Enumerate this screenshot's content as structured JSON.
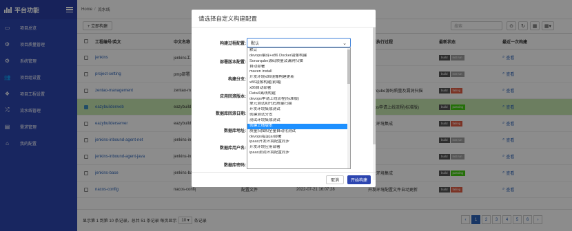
{
  "app": {
    "title": "平台功能"
  },
  "sidebar": {
    "items": [
      {
        "label": "项目总览",
        "icon": "monitor-icon"
      },
      {
        "label": "项目质量管理",
        "icon": "cog-icon"
      },
      {
        "label": "系统管理",
        "icon": "cog-icon"
      },
      {
        "label": "项目组设置",
        "icon": "users-icon"
      },
      {
        "label": "项目工程设置",
        "icon": "cluster-icon"
      },
      {
        "label": "流水线管理",
        "icon": "shuffle-icon"
      },
      {
        "label": "需求管理",
        "icon": "calendar-icon"
      },
      {
        "label": "我的配置",
        "icon": "sitemap-icon"
      }
    ]
  },
  "breadcrumb": {
    "home": "Home",
    "sep": "/",
    "current": "流水线"
  },
  "toolbar": {
    "add_label": "+ 立即构建",
    "search_placeholder": "搜索",
    "tools": [
      "⊙",
      "↻",
      "▦",
      "▦▾"
    ]
  },
  "table": {
    "headers": {
      "name": "工程编号/英文",
      "cn": "中文名称",
      "desc": "",
      "time": "",
      "proc": "最新执行过程",
      "status": "最新状态",
      "last": "最近一次构建"
    },
    "view_label": "查看",
    "rows": [
      {
        "name": "jenkins",
        "cn": "jenkins工",
        "desc": "",
        "time": "",
        "proc": "",
        "status": [
          [
            "build",
            "b1"
          ],
          [
            "not run",
            "b2"
          ]
        ],
        "selected": false
      },
      {
        "name": "project-setting",
        "cn": "pmp部署",
        "desc": "",
        "time": "",
        "proc": "",
        "status": [
          [
            "build",
            "b1"
          ],
          [
            "not run",
            "b2"
          ]
        ],
        "selected": false
      },
      {
        "name": "zentao-management",
        "cn": "zentao-m",
        "desc": "",
        "time": "",
        "proc": "onarqube源码质量及漏洞扫描",
        "status": [
          [
            "build",
            "b1"
          ],
          [
            "failing",
            "b3"
          ]
        ],
        "selected": false
      },
      {
        "name": "eazybuilderweb",
        "cn": "eazybuild",
        "desc": "",
        "time": "",
        "proc": "evops申请上线流程(标准版)",
        "status": [
          [
            "build",
            "b1"
          ],
          [
            "passing",
            "b4"
          ]
        ],
        "selected": true
      },
      {
        "name": "eazybuilderserver",
        "cn": "eazybuild",
        "desc": "",
        "time": "",
        "proc": "开发环境集成",
        "status": [
          [
            "build",
            "b1"
          ],
          [
            "failing",
            "b3"
          ]
        ],
        "selected": false
      },
      {
        "name": "jenkins-inbound-agent-net",
        "cn": "jenkins-in",
        "desc": "",
        "time": "",
        "proc": "",
        "status": [
          [
            "build",
            "b1"
          ],
          [
            "not run",
            "b2"
          ]
        ],
        "selected": false
      },
      {
        "name": "jenkins-inbound-agent-java",
        "cn": "jenkins-in",
        "desc": "",
        "time": "",
        "proc": "",
        "status": [
          [
            "build",
            "b1"
          ],
          [
            "not run",
            "b2"
          ]
        ],
        "selected": false
      },
      {
        "name": "jenkins-base",
        "cn": "jenkins-ba",
        "desc": "",
        "time": "",
        "proc": "开发环境集成",
        "status": [
          [
            "build",
            "b1"
          ],
          [
            "passing",
            "b4"
          ]
        ],
        "selected": false
      },
      {
        "name": "nacos-config",
        "cn": "nacos-config",
        "desc": "配置文件",
        "time": "2022-07-21 16:07:28",
        "proc": "开发环境配置文件自动更新",
        "status": [
          [
            "build",
            "b1"
          ],
          [
            "failing",
            "b3"
          ]
        ],
        "selected": false
      }
    ]
  },
  "footer": {
    "info_prefix": "显示第 1 到第 10 条记录，总共 51 条记录 每页显示",
    "page_size": "10",
    "info_suffix": "条记录",
    "pages": [
      "‹",
      "1",
      "2",
      "3",
      "4",
      "5",
      "6",
      "›"
    ],
    "active_page": "1"
  },
  "modal": {
    "title": "请选择自定义构建配置",
    "labels": [
      "构建过程配置:",
      "部署版本配置:",
      "构建分支:",
      "应用回滚版本:",
      "数据库回滚日期:",
      "数据库地址:",
      "数据库用户名:",
      "数据库密码:"
    ],
    "select_value": "默认",
    "options": [
      "默认",
      "devops编译+x86 Docker镜像构建",
      "Sonarqube源码质量及漏洞扫描",
      "自动部署",
      "maven install",
      "开发环境x86镜像构建更新",
      "x86镜像构建(前端)",
      "x86自动部署",
      "DataX离线构建",
      "devops申请上线流程(标准版)",
      "单元测试和代码质量扫描",
      "开发环境集成测试",
      "创建测试分支",
      "测试环境集成测试",
      "创建上线版本",
      "质量扫描和全量自动化测试",
      "devops指定jar部署",
      "ipaas开发环境配置同步",
      "开发环境应用部署",
      "ipaas测试环境配置同步"
    ],
    "selected_option": "创建上线版本",
    "cancel_label": "取消",
    "confirm_label": "开始构建"
  },
  "colors": {
    "sidebar": "#2c45b0",
    "accent": "#1e90ff",
    "selected_row": "#c5e6b0"
  }
}
